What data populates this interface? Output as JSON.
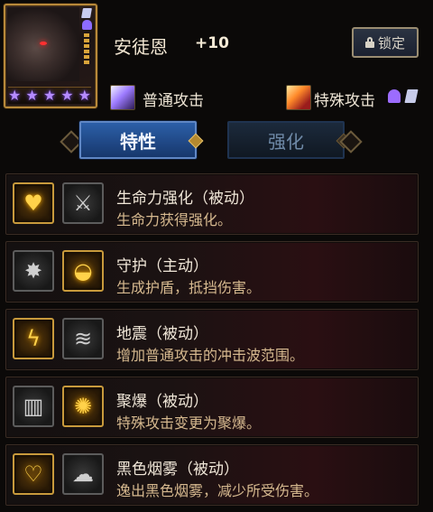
{
  "hero": {
    "name": "安徒恩",
    "plus": "+10",
    "star_count": 5,
    "lock_label": "锁定"
  },
  "attacks": {
    "normal": "普通攻击",
    "special": "特殊攻击"
  },
  "tabs": [
    {
      "label": "特性",
      "active": true
    },
    {
      "label": "强化",
      "active": false
    }
  ],
  "skills": [
    {
      "title": "生命力强化（被动）",
      "desc": "生命力获得强化。",
      "icon1": "heart-aura-icon",
      "icon2": "sword-icon"
    },
    {
      "title": "守护（主动）",
      "desc": "生成护盾，抵挡伤害。",
      "icon1": "claw-burst-icon",
      "icon2": "golden-shield-icon"
    },
    {
      "title": "地震（被动）",
      "desc": "增加普通攻击的冲击波范围。",
      "icon1": "lightning-burst-icon",
      "icon2": "claw-slash-icon"
    },
    {
      "title": "聚爆（被动）",
      "desc": "特殊攻击变更为聚爆。",
      "icon1": "crystal-pillar-icon",
      "icon2": "flame-burst-icon"
    },
    {
      "title": "黑色烟雾（被动）",
      "desc": "逸出黑色烟雾，减少所受伤害。",
      "icon1": "flaming-heart-icon",
      "icon2": "smoke-claw-icon"
    }
  ],
  "colors": {
    "gold_frame": "#c89a3c",
    "tab_active": "#2c5fa8",
    "desc_text": "#d6b98f",
    "star": "#b58bff"
  }
}
